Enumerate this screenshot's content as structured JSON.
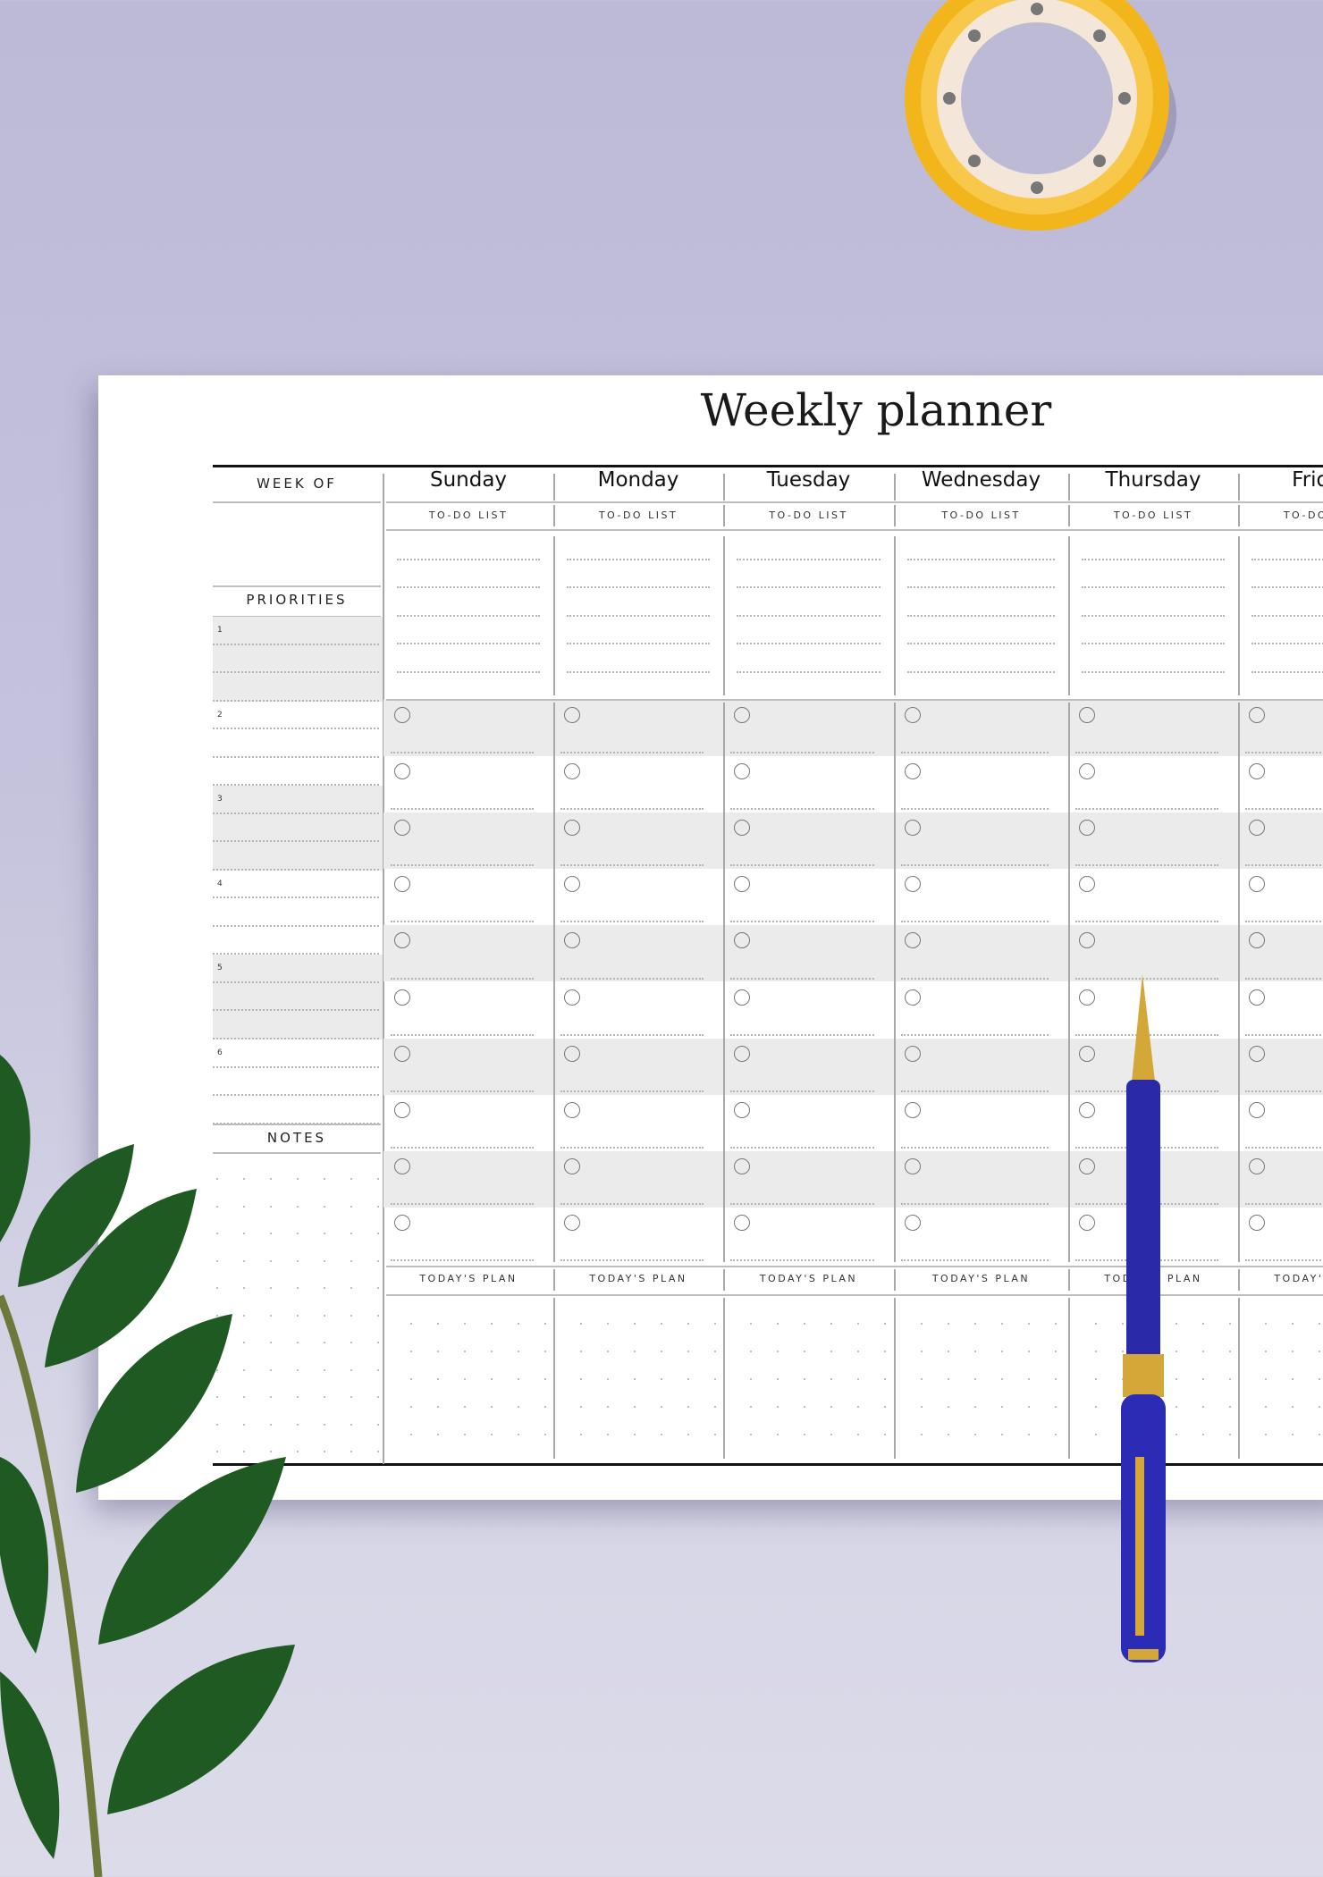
{
  "title": "Weekly planner",
  "sidebar": {
    "week_of_label": "WEEK OF",
    "priorities_label": "PRIORITIES",
    "priority_numbers": [
      "1",
      "2",
      "3",
      "4",
      "5",
      "6"
    ],
    "notes_label": "NOTES"
  },
  "days": [
    {
      "name": "Sunday",
      "todo_label": "TO-DO LIST",
      "plan_label": "TODAY'S PLAN"
    },
    {
      "name": "Monday",
      "todo_label": "TO-DO LIST",
      "plan_label": "TODAY'S PLAN"
    },
    {
      "name": "Tuesday",
      "todo_label": "TO-DO LIST",
      "plan_label": "TODAY'S PLAN"
    },
    {
      "name": "Wednesday",
      "todo_label": "TO-DO LIST",
      "plan_label": "TODAY'S PLAN"
    },
    {
      "name": "Thursday",
      "todo_label": "TO-DO LIST",
      "plan_label": "TODAY'S PLAN"
    },
    {
      "name": "Friday",
      "todo_label": "TO-DO LIST",
      "plan_label": "TODAY'S PLAN"
    }
  ],
  "colors": {
    "background": "#bcbad6",
    "row_shade": "#ebebeb",
    "pen_body": "#2a2aa8",
    "pen_gold": "#d4a838",
    "tape": "#f2b61c",
    "leaf": "#1f5a22"
  }
}
